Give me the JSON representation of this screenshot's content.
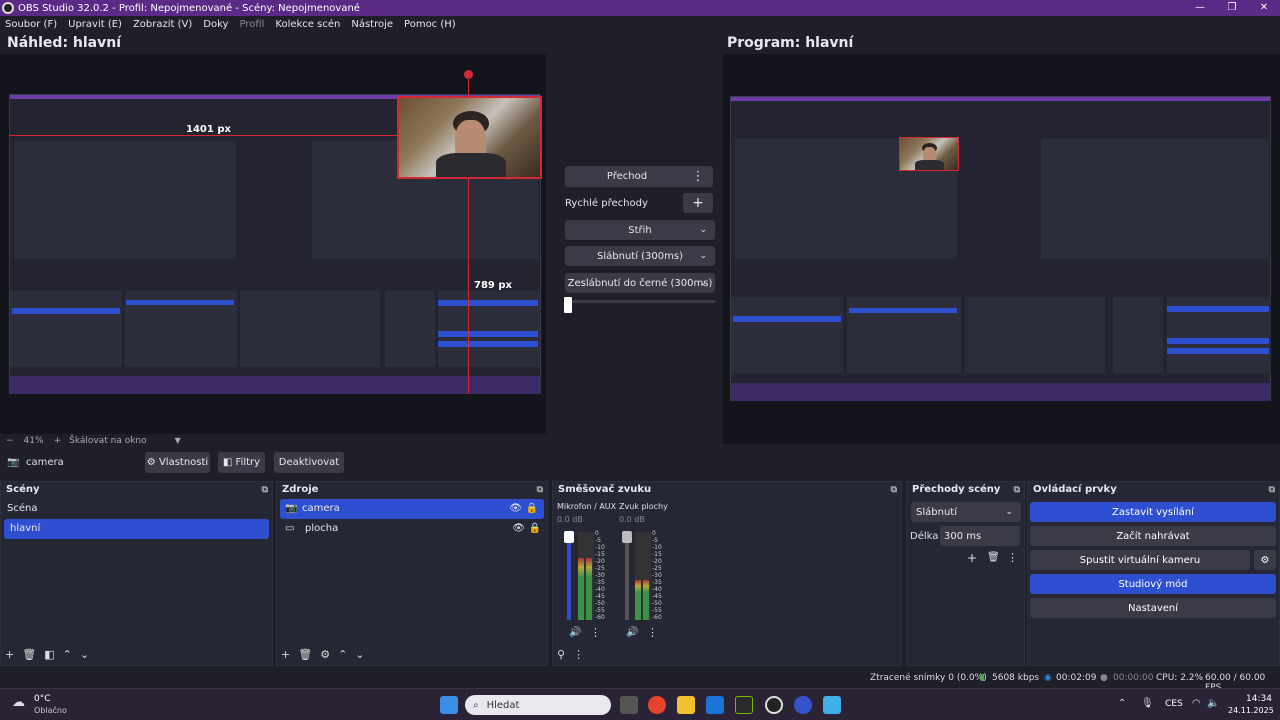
{
  "window": {
    "title": "OBS Studio 32.0.2 - Profil: Nepojmenované - Scény: Nepojmenované",
    "controls": [
      "—",
      "❐",
      "✕"
    ]
  },
  "menu": [
    "Soubor (F)",
    "Upravit (E)",
    "Zobrazit (V)",
    "Doky",
    "Profil",
    "Kolekce scén",
    "Nástroje",
    "Pomoc (H)"
  ],
  "preview": {
    "label": "Náhled: hlavní",
    "width_label": "1401 px",
    "height_label": "789 px",
    "zoom": "41%",
    "scale_mode": "Škálovat na okno"
  },
  "program": {
    "label": "Program: hlavní"
  },
  "transitions_panel": {
    "transition_button": "Přechod",
    "quick_label": "Rychlé přechody",
    "items": [
      "Střih",
      "Slábnutí (300ms)",
      "Zeslábnutí do černé (300ms)"
    ]
  },
  "source_toolbar": {
    "source_name": "camera",
    "properties": "Vlastnosti",
    "filters": "Filtry",
    "deactivate": "Deaktivovat"
  },
  "scenes": {
    "title": "Scény",
    "items": [
      {
        "name": "Scéna",
        "selected": false
      },
      {
        "name": "hlavní",
        "selected": true
      }
    ]
  },
  "sources": {
    "title": "Zdroje",
    "items": [
      {
        "name": "camera",
        "selected": true,
        "icon": "camera-icon"
      },
      {
        "name": "plocha",
        "selected": false,
        "icon": "monitor-icon"
      }
    ]
  },
  "mixer": {
    "title": "Směšovač zvuku",
    "channels": [
      {
        "name": "Mikrofon / AUX",
        "db": "0.0 dB",
        "level": 0.7
      },
      {
        "name": "Zvuk plochy",
        "db": "0.0 dB",
        "level": 0.45
      }
    ],
    "scale": [
      "0",
      "-5",
      "-10",
      "-15",
      "-20",
      "-25",
      "-30",
      "-35",
      "-40",
      "-45",
      "-50",
      "-55",
      "-60"
    ]
  },
  "scene_transitions": {
    "title": "Přechody scény",
    "selected": "Slábnutí",
    "duration_label": "Délka",
    "duration_value": "300 ms"
  },
  "controls": {
    "title": "Ovládací prvky",
    "stop_stream": "Zastavit vysílání",
    "start_recording": "Začít nahrávat",
    "virtual_camera": "Spustit virtuální kameru",
    "studio_mode": "Studiový mód",
    "settings": "Nastavení"
  },
  "status": {
    "dropped": "Ztracené snímky 0 (0.0%)",
    "bitrate": "5608 kbps",
    "stream_time": "00:02:09",
    "rec_time": "00:00:00",
    "cpu": "CPU: 2.2%",
    "fps": "60.00 / 60.00 FPS"
  },
  "taskbar": {
    "weather_temp": "0°C",
    "weather_desc": "Oblačno",
    "search_placeholder": "Hledat",
    "language": "CES",
    "time": "14:34",
    "date": "24.11.2025"
  },
  "colors": {
    "accent": "#2f4fd1",
    "titlebar": "#5b2a86",
    "selection_red": "#d12836"
  }
}
